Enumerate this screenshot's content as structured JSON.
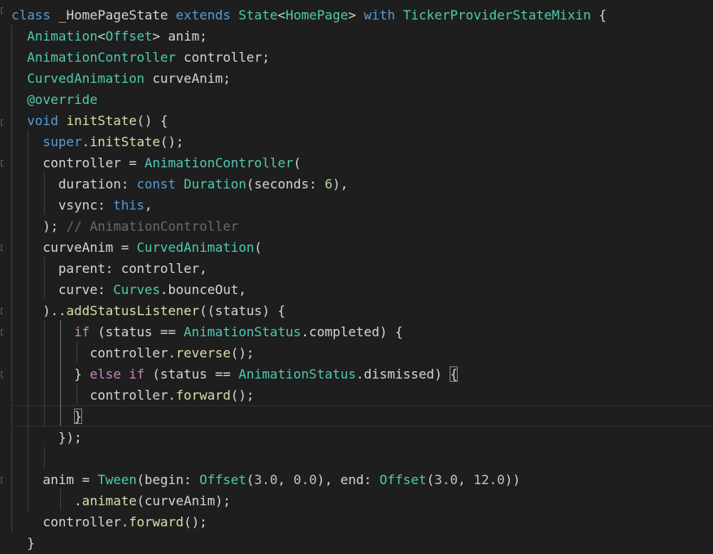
{
  "editor": {
    "colors": {
      "background": "#1e1e1e",
      "text": "#d4d4d4",
      "keyword": "#569cd6",
      "control": "#c586c0",
      "type": "#4ec9b0",
      "function": "#dcdcaa",
      "number": "#b5cea8",
      "comment": "#6a6a6a"
    },
    "lines": [
      [
        [
          "kw",
          "class"
        ],
        [
          "plain",
          " _HomePageState "
        ],
        [
          "kw",
          "extends"
        ],
        [
          "plain",
          " "
        ],
        [
          "ty",
          "State"
        ],
        [
          "plain",
          "<"
        ],
        [
          "ty",
          "HomePage"
        ],
        [
          "plain",
          "> "
        ],
        [
          "kw",
          "with"
        ],
        [
          "plain",
          " "
        ],
        [
          "ty",
          "TickerProviderStateMixin"
        ],
        [
          "plain",
          " {"
        ]
      ],
      [
        [
          "plain",
          "  "
        ],
        [
          "ty",
          "Animation"
        ],
        [
          "plain",
          "<"
        ],
        [
          "ty",
          "Offset"
        ],
        [
          "plain",
          "> anim;"
        ]
      ],
      [
        [
          "plain",
          "  "
        ],
        [
          "ty",
          "AnimationController"
        ],
        [
          "plain",
          " controller;"
        ]
      ],
      [
        [
          "plain",
          "  "
        ],
        [
          "ty",
          "CurvedAnimation"
        ],
        [
          "plain",
          " curveAnim;"
        ]
      ],
      [
        [
          "plain",
          "  "
        ],
        [
          "ann",
          "@override"
        ]
      ],
      [
        [
          "plain",
          "  "
        ],
        [
          "kw",
          "void"
        ],
        [
          "plain",
          " "
        ],
        [
          "fn",
          "initState"
        ],
        [
          "plain",
          "() {"
        ]
      ],
      [
        [
          "plain",
          "    "
        ],
        [
          "kw",
          "super"
        ],
        [
          "plain",
          "."
        ],
        [
          "fn",
          "initState"
        ],
        [
          "plain",
          "();"
        ]
      ],
      [
        [
          "plain",
          "    controller = "
        ],
        [
          "ty",
          "AnimationController"
        ],
        [
          "plain",
          "("
        ]
      ],
      [
        [
          "plain",
          "      duration: "
        ],
        [
          "kw",
          "const"
        ],
        [
          "plain",
          " "
        ],
        [
          "ty",
          "Duration"
        ],
        [
          "plain",
          "(seconds: "
        ],
        [
          "num",
          "6"
        ],
        [
          "plain",
          "),"
        ]
      ],
      [
        [
          "plain",
          "      vsync: "
        ],
        [
          "kw",
          "this"
        ],
        [
          "plain",
          ","
        ]
      ],
      [
        [
          "plain",
          "    ); "
        ],
        [
          "cmt",
          "// AnimationController"
        ]
      ],
      [
        [
          "plain",
          "    curveAnim = "
        ],
        [
          "ty",
          "CurvedAnimation"
        ],
        [
          "plain",
          "("
        ]
      ],
      [
        [
          "plain",
          "      parent: controller,"
        ]
      ],
      [
        [
          "plain",
          "      curve: "
        ],
        [
          "ty",
          "Curves"
        ],
        [
          "plain",
          ".bounceOut,"
        ]
      ],
      [
        [
          "plain",
          "    ).."
        ],
        [
          "fn",
          "addStatusListener"
        ],
        [
          "plain",
          "((status) {"
        ]
      ],
      [
        [
          "plain",
          "        "
        ],
        [
          "ctl",
          "if"
        ],
        [
          "plain",
          " (status == "
        ],
        [
          "ty",
          "AnimationStatus"
        ],
        [
          "plain",
          ".completed) {"
        ]
      ],
      [
        [
          "plain",
          "          controller."
        ],
        [
          "fn",
          "reverse"
        ],
        [
          "plain",
          "();"
        ]
      ],
      [
        [
          "plain",
          "        } "
        ],
        [
          "ctl",
          "else"
        ],
        [
          "plain",
          " "
        ],
        [
          "ctl",
          "if"
        ],
        [
          "plain",
          " (status == "
        ],
        [
          "ty",
          "AnimationStatus"
        ],
        [
          "plain",
          ".dismissed) "
        ],
        [
          "bracket",
          "{"
        ]
      ],
      [
        [
          "plain",
          "          controller."
        ],
        [
          "fn",
          "forward"
        ],
        [
          "plain",
          "();"
        ]
      ],
      [
        [
          "plain",
          "        "
        ],
        [
          "bracket",
          "}"
        ]
      ],
      [
        [
          "plain",
          "      });"
        ]
      ],
      [
        [
          "plain",
          ""
        ]
      ],
      [
        [
          "plain",
          "    anim = "
        ],
        [
          "ty",
          "Tween"
        ],
        [
          "plain",
          "(begin: "
        ],
        [
          "ty",
          "Offset"
        ],
        [
          "plain",
          "("
        ],
        [
          "num",
          "3.0"
        ],
        [
          "plain",
          ", "
        ],
        [
          "num",
          "0.0"
        ],
        [
          "plain",
          "), end: "
        ],
        [
          "ty",
          "Offset"
        ],
        [
          "plain",
          "("
        ],
        [
          "num",
          "3.0"
        ],
        [
          "plain",
          ", "
        ],
        [
          "num",
          "12.0"
        ],
        [
          "plain",
          "))"
        ]
      ],
      [
        [
          "plain",
          "        ."
        ],
        [
          "fn",
          "animate"
        ],
        [
          "plain",
          "(curveAnim);"
        ]
      ],
      [
        [
          "plain",
          "    controller."
        ],
        [
          "fn",
          "forward"
        ],
        [
          "plain",
          "();"
        ]
      ],
      [
        [
          "plain",
          "  }"
        ]
      ]
    ]
  }
}
